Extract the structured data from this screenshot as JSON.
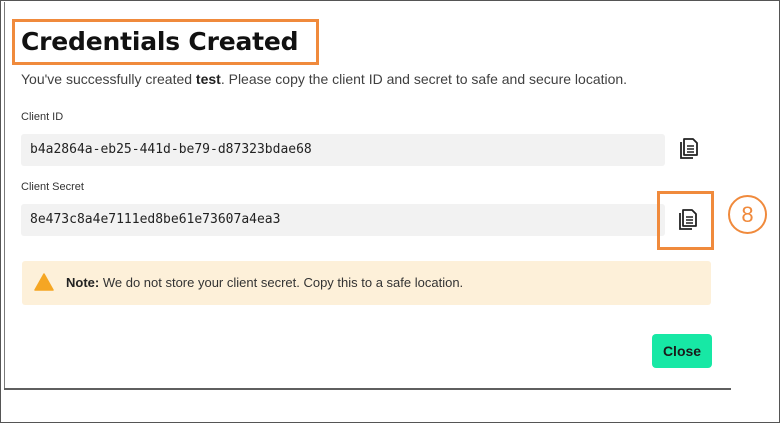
{
  "dialog": {
    "title": "Credentials Created",
    "subtitle_prefix": "You've successfully created ",
    "subtitle_name": "test",
    "subtitle_suffix": ". Please copy the client ID and secret to safe and secure location."
  },
  "client_id": {
    "label": "Client ID",
    "value": "b4a2864a-eb25-441d-be79-d87323bdae68"
  },
  "client_secret": {
    "label": "Client Secret",
    "value": "8e473c8a4e7111ed8be61e73607a4ea3"
  },
  "note": {
    "prefix": "Note:",
    "text": " We do not store your client secret. Copy this to a safe location."
  },
  "annotation": {
    "step_number": "8"
  },
  "actions": {
    "close_label": "Close"
  },
  "icons": {
    "copy": "copy-icon",
    "warning": "warning-icon"
  },
  "colors": {
    "annotation_orange": "#f08a3c",
    "close_button": "#17e8a5",
    "note_background": "#fdf0d9",
    "warning_icon": "#f5a623",
    "field_background": "#f2f2f2"
  }
}
